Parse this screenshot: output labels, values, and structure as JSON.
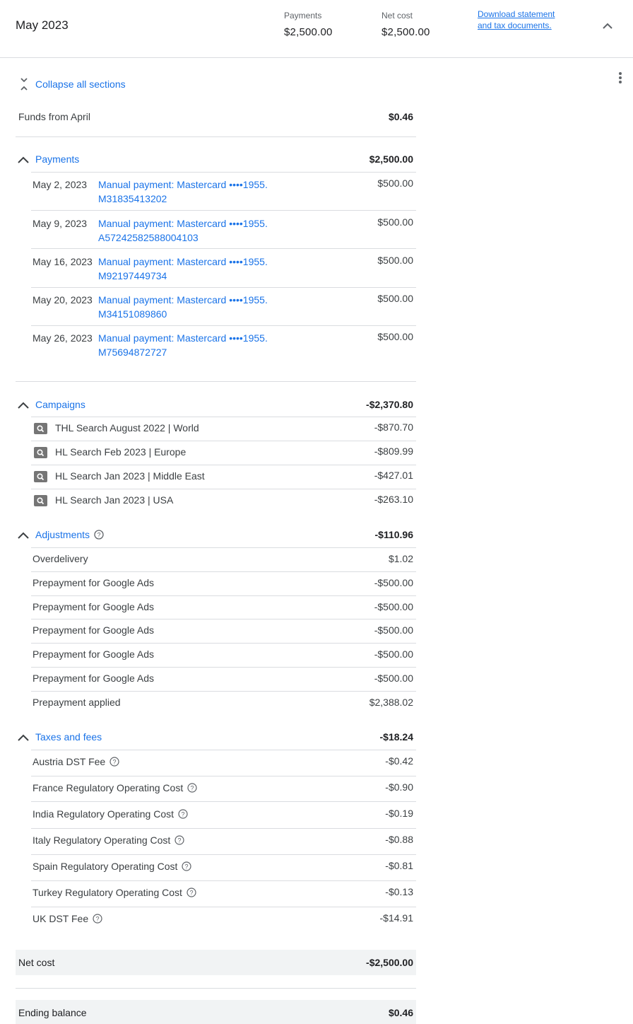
{
  "header": {
    "month": "May 2023",
    "payments_label": "Payments",
    "payments_value": "$2,500.00",
    "net_cost_label": "Net cost",
    "net_cost_value": "$2,500.00",
    "download_link": "Download statement and tax documents.",
    "chevron_icon": "chevron-up-icon"
  },
  "toolbar": {
    "collapse_all": "Collapse all sections",
    "more_icon": "more-vert-icon"
  },
  "funds_from": {
    "label": "Funds from April",
    "amount": "$0.46"
  },
  "payments": {
    "title": "Payments",
    "total": "$2,500.00",
    "items": [
      {
        "date": "May 2, 2023",
        "desc": "Manual payment: Mastercard ••••1955. M31835413202",
        "amount": "$500.00"
      },
      {
        "date": "May 9, 2023",
        "desc": "Manual payment: Mastercard ••••1955. A57242582588004103",
        "amount": "$500.00"
      },
      {
        "date": "May 16, 2023",
        "desc": "Manual payment: Mastercard ••••1955. M92197449734",
        "amount": "$500.00"
      },
      {
        "date": "May 20, 2023",
        "desc": "Manual payment: Mastercard ••••1955. M34151089860",
        "amount": "$500.00"
      },
      {
        "date": "May 26, 2023",
        "desc": "Manual payment: Mastercard ••••1955. M75694872727",
        "amount": "$500.00"
      }
    ]
  },
  "campaigns": {
    "title": "Campaigns",
    "total": "-$2,370.80",
    "items": [
      {
        "name": "THL Search August 2022 | World",
        "amount": "-$870.70"
      },
      {
        "name": "HL Search Feb 2023 | Europe",
        "amount": "-$809.99"
      },
      {
        "name": "HL Search Jan 2023 | Middle East",
        "amount": "-$427.01"
      },
      {
        "name": "HL Search Jan 2023 | USA",
        "amount": "-$263.10"
      }
    ]
  },
  "adjustments": {
    "title": "Adjustments",
    "total": "-$110.96",
    "items": [
      {
        "name": "Overdelivery",
        "amount": "$1.02"
      },
      {
        "name": "Prepayment for Google Ads",
        "amount": "-$500.00"
      },
      {
        "name": "Prepayment for Google Ads",
        "amount": "-$500.00"
      },
      {
        "name": "Prepayment for Google Ads",
        "amount": "-$500.00"
      },
      {
        "name": "Prepayment for Google Ads",
        "amount": "-$500.00"
      },
      {
        "name": "Prepayment for Google Ads",
        "amount": "-$500.00"
      },
      {
        "name": "Prepayment applied",
        "amount": "$2,388.02"
      }
    ]
  },
  "taxes": {
    "title": "Taxes and fees",
    "total": "-$18.24",
    "items": [
      {
        "name": "Austria DST Fee",
        "amount": "-$0.42"
      },
      {
        "name": "France Regulatory Operating Cost",
        "amount": "-$0.90"
      },
      {
        "name": "India Regulatory Operating Cost",
        "amount": "-$0.19"
      },
      {
        "name": "Italy Regulatory Operating Cost",
        "amount": "-$0.88"
      },
      {
        "name": "Spain Regulatory Operating Cost",
        "amount": "-$0.81"
      },
      {
        "name": "Turkey Regulatory Operating Cost",
        "amount": "-$0.13"
      },
      {
        "name": "UK DST Fee",
        "amount": "-$14.91"
      }
    ]
  },
  "net_cost": {
    "label": "Net cost",
    "amount": "-$2,500.00"
  },
  "ending_balance": {
    "label": "Ending balance",
    "amount": "$0.46"
  },
  "colors": {
    "link": "#1a73e8",
    "divider": "#dadce0",
    "total_bg": "#f1f3f4"
  }
}
